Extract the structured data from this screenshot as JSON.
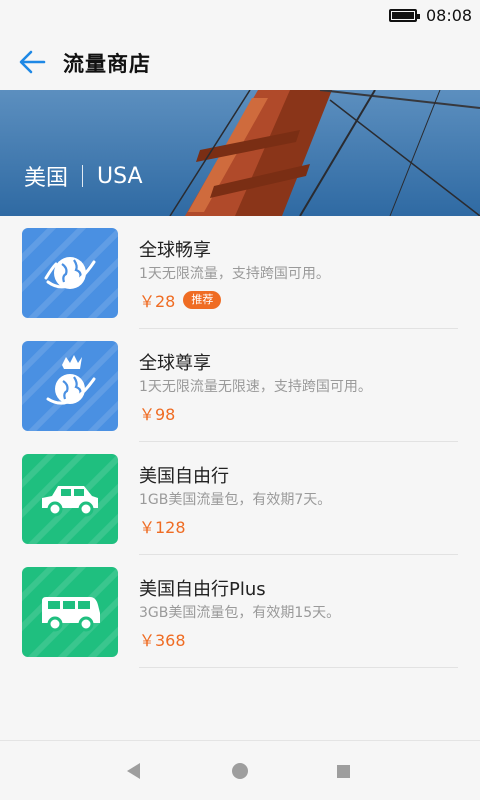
{
  "status_bar": {
    "time": "08:08"
  },
  "header": {
    "title": "流量商店",
    "back_icon": "arrow-left-icon"
  },
  "banner": {
    "country_cn": "美国",
    "country_en": "USA"
  },
  "colors": {
    "accent": "#1e88e5",
    "price": "#ef6c23",
    "tile_blue": "#4a90e2",
    "tile_green": "#1fbf7f"
  },
  "products": [
    {
      "name": "全球畅享",
      "desc": "1天无限流量，支持跨国可用。",
      "price": "￥28",
      "badge": "推荐",
      "icon": "globe-icon"
    },
    {
      "name": "全球尊享",
      "desc": "1天无限流量无限速，支持跨国可用。",
      "price": "￥98",
      "icon": "crowned-globe-icon"
    },
    {
      "name": "美国自由行",
      "desc": "1GB美国流量包，有效期7天。",
      "price": "￥128",
      "icon": "car-icon"
    },
    {
      "name": "美国自由行Plus",
      "desc": "3GB美国流量包，有效期15天。",
      "price": "￥368",
      "icon": "van-icon"
    }
  ],
  "nav_bar": {
    "icons": [
      "back-triangle-icon",
      "home-circle-icon",
      "recents-square-icon"
    ]
  }
}
